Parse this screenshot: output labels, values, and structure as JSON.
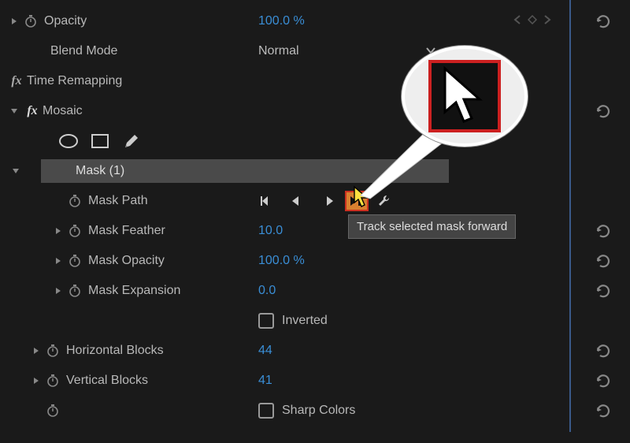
{
  "effects": {
    "opacity": {
      "label": "Opacity",
      "value": "100.0 %"
    },
    "blendMode": {
      "label": "Blend Mode",
      "value": "Normal"
    },
    "timeRemapping": {
      "label": "Time Remapping"
    },
    "mosaic": {
      "label": "Mosaic"
    },
    "mask": {
      "header": "Mask (1)",
      "path": {
        "label": "Mask Path"
      },
      "feather": {
        "label": "Mask Feather",
        "value": "10.0"
      },
      "opacity": {
        "label": "Mask Opacity",
        "value": "100.0 %"
      },
      "expansion": {
        "label": "Mask Expansion",
        "value": "0.0"
      },
      "inverted": {
        "label": "Inverted"
      }
    },
    "hBlocks": {
      "label": "Horizontal Blocks",
      "value": "44"
    },
    "vBlocks": {
      "label": "Vertical Blocks",
      "value": "41"
    },
    "sharpColors": {
      "label": "Sharp Colors"
    }
  },
  "tooltip": "Track selected mask forward"
}
